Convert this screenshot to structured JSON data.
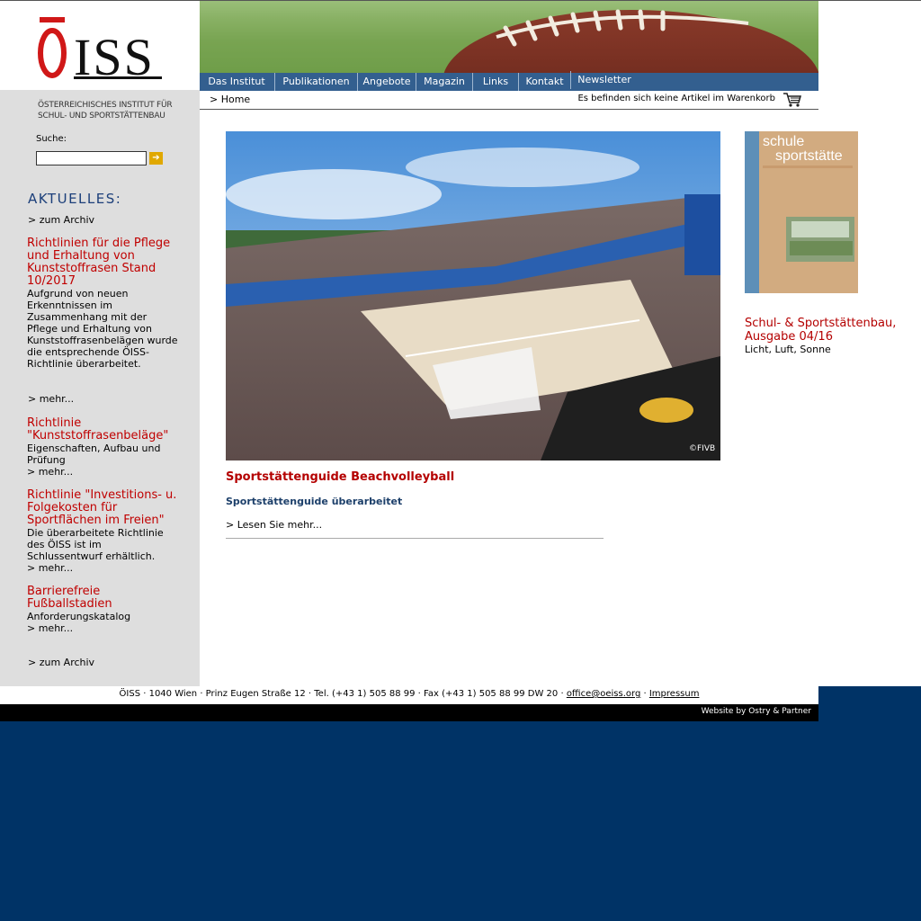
{
  "brand": {
    "logo_text": "ÖISS",
    "institute_line1": "ÖSTERREICHISCHES INSTITUT FÜR",
    "institute_line2": "SCHUL- UND SPORTSTÄTTENBAU"
  },
  "search": {
    "label": "Suche:",
    "value": "",
    "go_symbol": "➔"
  },
  "nav": {
    "items": [
      "Das Institut",
      "Publikationen",
      "Angebote",
      "Magazin",
      "Links",
      "Kontakt",
      "Newsletter"
    ]
  },
  "breadcrumb": "> Home",
  "cart": {
    "message": "Es befinden sich keine Artikel im Warenkorb",
    "icon": "shopping-cart-icon"
  },
  "sidebar": {
    "heading": "AKTUELLES:",
    "archive_link_top": "> zum Archiv",
    "archive_link_bottom": "> zum Archiv",
    "news": [
      {
        "title": "Richtlinien für die Pflege und Erhaltung von Kunststoffrasen Stand 10/2017",
        "body": "Aufgrund von neuen Erkenntnissen im Zusammenhang mit der Pflege und Erhaltung von Kunststoffrasenbelägen wurde die entsprechende ÖISS-Richtlinie überarbeitet.",
        "more": "> mehr..."
      },
      {
        "title": "Richtlinie \"Kunststoffrasenbeläge\"",
        "body": "Eigenschaften, Aufbau und Prüfung",
        "more": "> mehr..."
      },
      {
        "title": "Richtlinie \"Investitions- u. Folgekosten für Sportflächen im Freien\"",
        "body": "Die überarbeitete Richtlinie des ÖISS ist im Schlussentwurf erhältlich.",
        "more": "> mehr..."
      },
      {
        "title": "Barrierefreie Fußballstadien",
        "body": "Anforderungskatalog",
        "more": "> mehr..."
      }
    ]
  },
  "article": {
    "title": "Sportstättenguide Beachvolleyball",
    "subtitle": "Sportstättenguide überarbeitet",
    "more": "> Lesen Sie mehr...",
    "photo_credit": "©FIVB"
  },
  "magazine": {
    "cover_title_1": "schule",
    "cover_title_2": "sportstätte",
    "title": "Schul- & Sportstättenbau, Ausgabe 04/16",
    "subtitle": "Licht, Luft, Sonne"
  },
  "footer": {
    "address": "ÖISS · 1040 Wien · Prinz Eugen Straße 12 · Tel. (+43 1) 505 88 99 · Fax (+43 1) 505 88 99 DW 20 · ",
    "email": "office@oeiss.org",
    "separator": " · ",
    "imprint": "Impressum",
    "credits": "Website by Ostry & Partner"
  },
  "colors": {
    "nav_bg": "#335f8f",
    "accent_red": "#b40000",
    "page_bg": "#003366",
    "sidebar_bg": "#dedede"
  }
}
